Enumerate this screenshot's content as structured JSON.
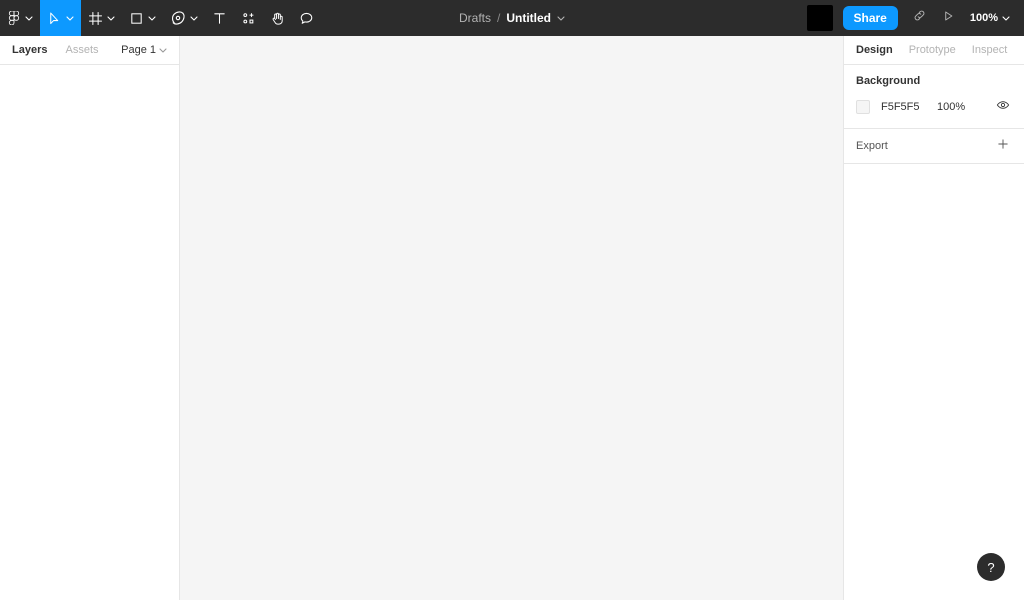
{
  "toolbar": {
    "menu": {
      "icon": "figma-logo-icon",
      "caret": "chevron-down-icon"
    },
    "tools": [
      {
        "id": "move",
        "label": "Move",
        "icon": "cursor-arrow-icon",
        "active": true,
        "caret": true
      },
      {
        "id": "frame",
        "label": "Frame",
        "icon": "frame-icon",
        "active": false,
        "caret": true
      },
      {
        "id": "shape",
        "label": "Rectangle",
        "icon": "square-icon",
        "active": false,
        "caret": true
      },
      {
        "id": "pen",
        "label": "Pen",
        "icon": "pen-icon",
        "active": false,
        "caret": true
      },
      {
        "id": "text",
        "label": "Text",
        "icon": "text-t-icon",
        "active": false,
        "caret": false
      },
      {
        "id": "resources",
        "label": "Resources",
        "icon": "components-icon",
        "active": false,
        "caret": false
      },
      {
        "id": "hand",
        "label": "Hand",
        "icon": "hand-icon",
        "active": false,
        "caret": false
      },
      {
        "id": "comment",
        "label": "Comment",
        "icon": "comment-bubble-icon",
        "active": false,
        "caret": false
      }
    ],
    "title": {
      "folder": "Drafts",
      "separator": "/",
      "name": "Untitled",
      "caret": "chevron-down-icon"
    },
    "right": {
      "avatar_color": "#000000",
      "share_label": "Share",
      "share_color": "#0d99ff",
      "link_icon": "link-icon",
      "present_icon": "play-icon",
      "zoom_value": "100%",
      "zoom_caret": "chevron-down-icon"
    }
  },
  "left_panel": {
    "tabs": [
      {
        "label": "Layers",
        "active": true
      },
      {
        "label": "Assets",
        "active": false
      }
    ],
    "page": {
      "name": "Page 1",
      "caret": "chevron-down-icon"
    }
  },
  "canvas": {
    "background_color": "#f5f5f5"
  },
  "right_panel": {
    "tabs": [
      {
        "label": "Design",
        "active": true
      },
      {
        "label": "Prototype",
        "active": false
      },
      {
        "label": "Inspect",
        "active": false
      }
    ],
    "background": {
      "title": "Background",
      "swatch_color": "#f5f5f5",
      "hex": "F5F5F5",
      "opacity": "100%",
      "visibility_icon": "eye-icon"
    },
    "export": {
      "label": "Export",
      "add_icon": "plus-icon"
    }
  },
  "help": {
    "label": "?"
  }
}
